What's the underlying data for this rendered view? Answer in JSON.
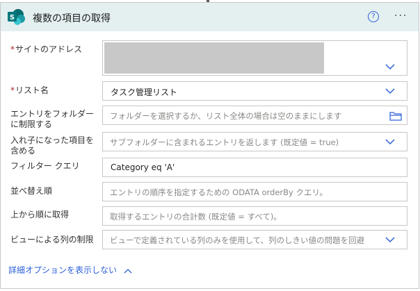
{
  "header": {
    "app_icon": "sharepoint-icon",
    "app_icon_letter": "S",
    "title": "複数の項目の取得",
    "help_icon": "help-circle-icon",
    "help_glyph": "?",
    "more_icon": "more-options-icon",
    "more_glyph": "···"
  },
  "fields": {
    "site": {
      "required_mark": "*",
      "label": "サイトのアドレス",
      "value": ""
    },
    "list": {
      "required_mark": "*",
      "label": "リスト名",
      "value": "タスク管理リスト"
    },
    "folder": {
      "label_line1": "エントリをフォルダー",
      "label_line2": "に制限する",
      "placeholder": "フォルダーを選択するか、リスト全体の場合は空のままにします"
    },
    "nested": {
      "label_line1": "入れ子になった項目を",
      "label_line2": "含める",
      "placeholder": "サブフォルダーに含まれるエントリを返します (既定値 = true)"
    },
    "filter": {
      "label": "フィルター クエリ",
      "value": "Category eq 'A'"
    },
    "orderby": {
      "label": "並べ替え順",
      "placeholder": "エントリの順序を指定するための ODATA orderBy クエリ。"
    },
    "top": {
      "label": "上から順に取得",
      "placeholder": "取得するエントリの合計数 (既定値 = すべて)。"
    },
    "view": {
      "label": "ビューによる列の制限",
      "placeholder": "ビューで定義されている列のみを使用して、列のしきい値の問題を回避"
    }
  },
  "advanced": {
    "label": "詳細オプションを表示しない",
    "icon": "chevron-up-icon"
  },
  "colors": {
    "accent": "#2b5fd9",
    "header_bg": "#e4eff0",
    "sharepoint": "#03787c",
    "required": "#a4262c"
  }
}
